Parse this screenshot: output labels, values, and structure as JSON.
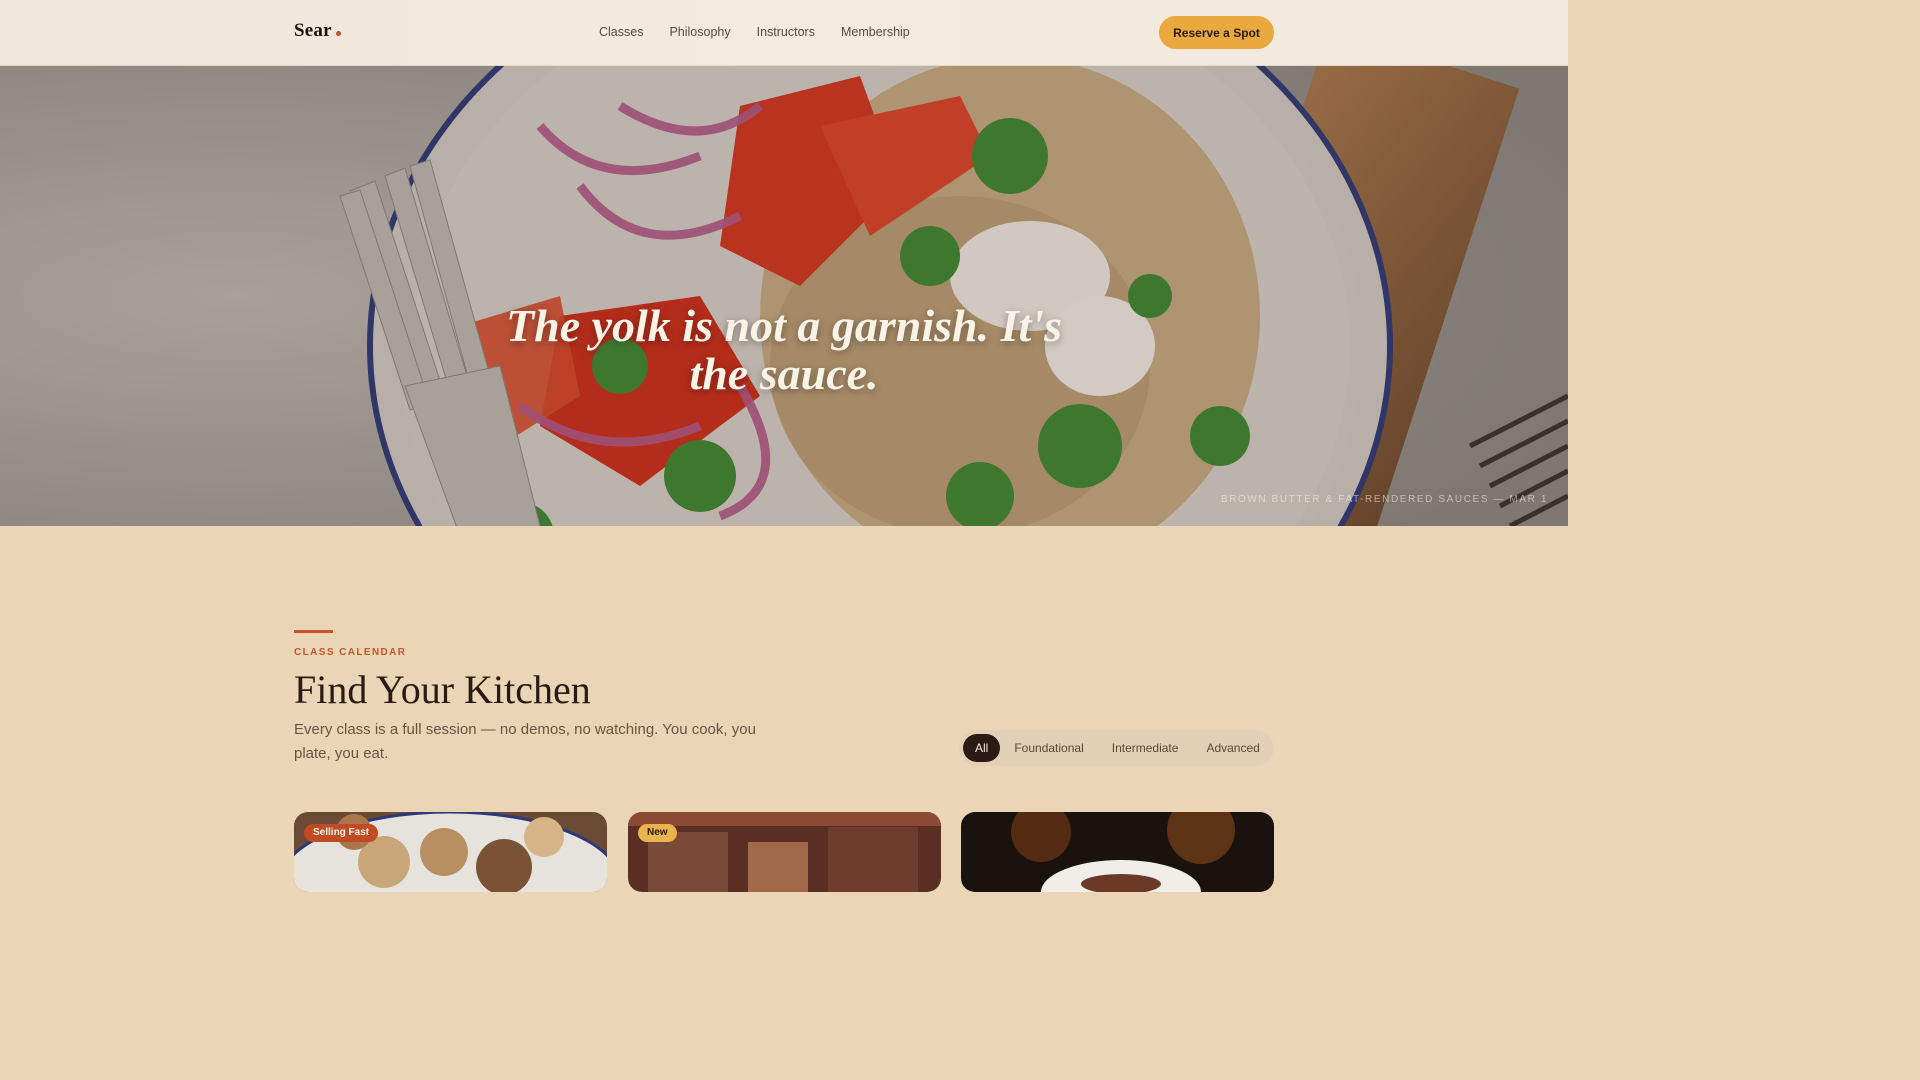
{
  "nav": {
    "brand": "Sear",
    "links": [
      "Classes",
      "Philosophy",
      "Instructors",
      "Membership"
    ],
    "cta": "Reserve a Spot"
  },
  "hero": {
    "quote": "The yolk is not a garnish. It's the sauce.",
    "caption": "BROWN BUTTER & FAT-RENDERED SAUCES — MAR 1"
  },
  "calendar": {
    "eyebrow": "CLASS CALENDAR",
    "title": "Find Your Kitchen",
    "description": "Every class is a full session — no demos, no watching. You cook, you plate, you eat.",
    "filters": [
      "All",
      "Foundational",
      "Intermediate",
      "Advanced"
    ],
    "active_filter": "All",
    "cards": [
      {
        "badge": "Selling Fast",
        "badge_style": "red"
      },
      {
        "badge": "New",
        "badge_style": "gold"
      },
      {
        "badge": "",
        "badge_style": ""
      }
    ]
  },
  "colors": {
    "accent": "#c8512a",
    "cta": "#e9a93f",
    "page_bg": "#ead6b7",
    "dark": "#2c1b14"
  }
}
